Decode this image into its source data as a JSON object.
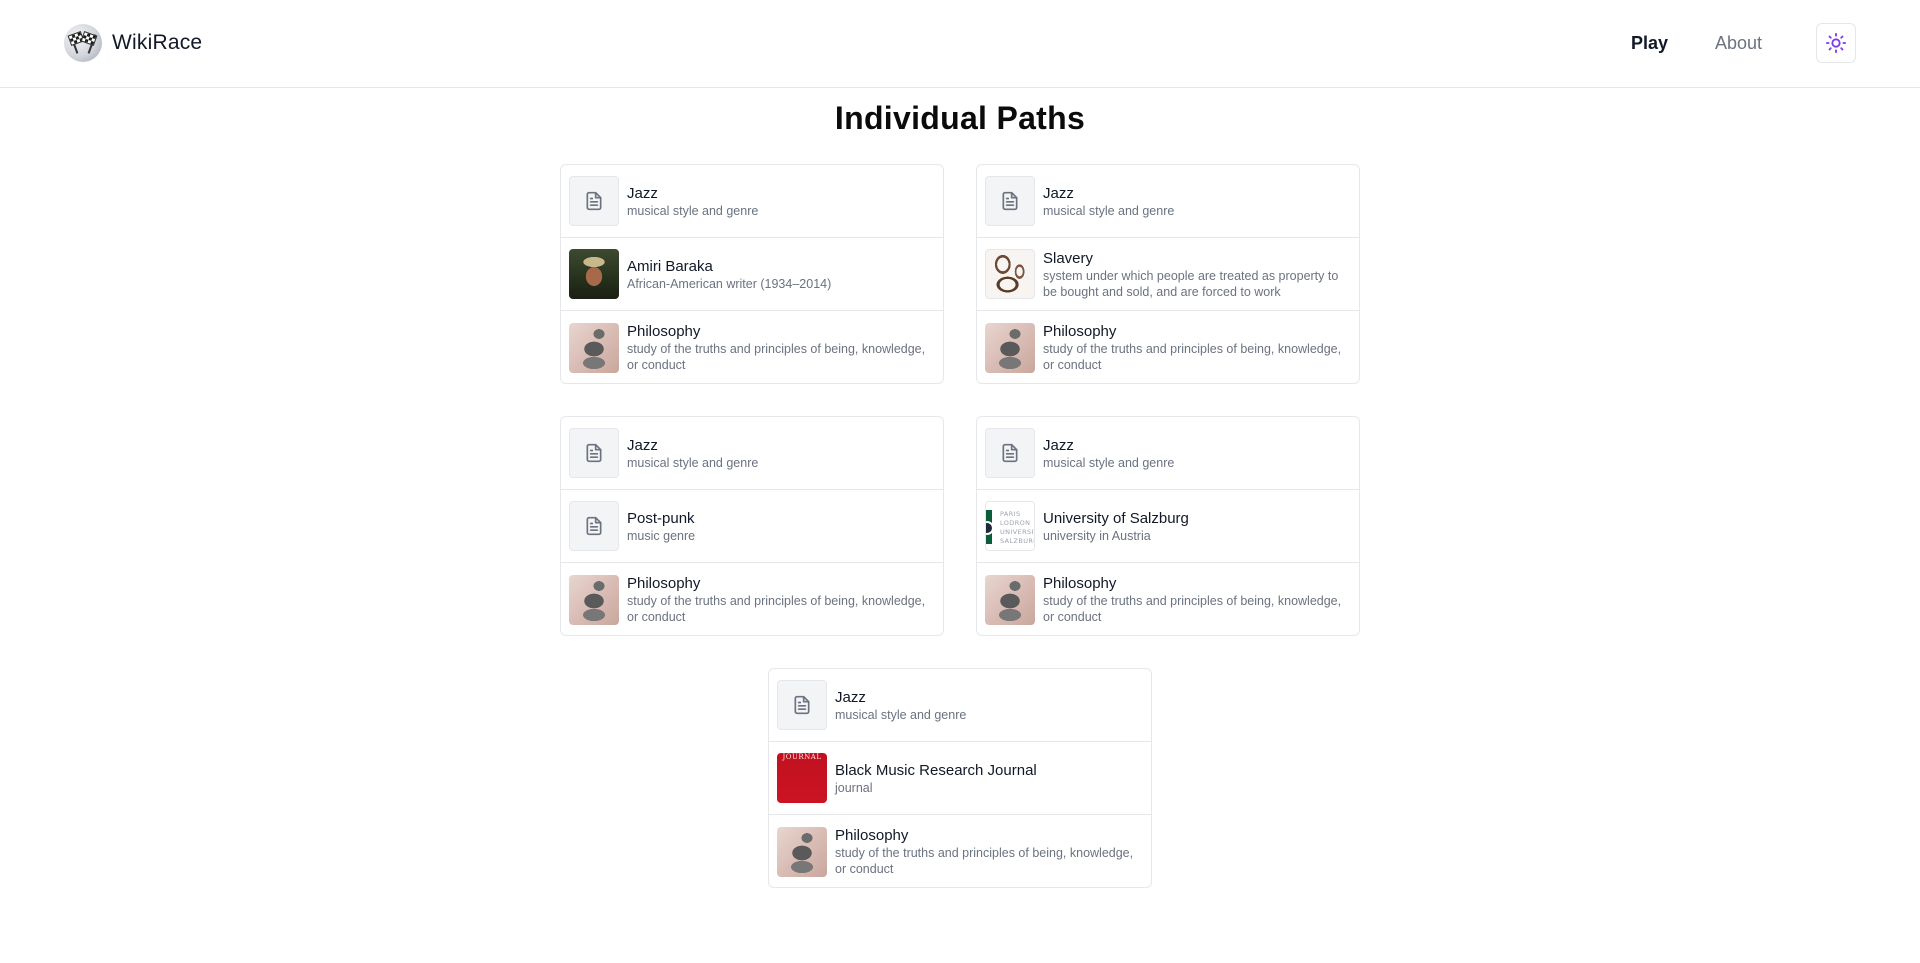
{
  "header": {
    "brand": "WikiRace",
    "nav": {
      "play": "Play",
      "about": "About"
    },
    "theme_icon": "sun-icon"
  },
  "page": {
    "title": "Individual Paths"
  },
  "paths": [
    [
      {
        "title": "Jazz",
        "desc": "musical style and genre",
        "thumb": "document-icon"
      },
      {
        "title": "Amiri Baraka",
        "desc": "African-American writer (1934–2014)",
        "thumb": "photo"
      },
      {
        "title": "Philosophy",
        "desc": "study of the truths and principles of being, knowledge, or conduct",
        "thumb": "photo"
      }
    ],
    [
      {
        "title": "Jazz",
        "desc": "musical style and genre",
        "thumb": "document-icon"
      },
      {
        "title": "Slavery",
        "desc": "system under which people are treated as property to be bought and sold, and are forced to work",
        "thumb": "photo"
      },
      {
        "title": "Philosophy",
        "desc": "study of the truths and principles of being, knowledge, or conduct",
        "thumb": "photo"
      }
    ],
    [
      {
        "title": "Jazz",
        "desc": "musical style and genre",
        "thumb": "document-icon"
      },
      {
        "title": "Post-punk",
        "desc": "music genre",
        "thumb": "document-icon"
      },
      {
        "title": "Philosophy",
        "desc": "study of the truths and principles of being, knowledge, or conduct",
        "thumb": "photo"
      }
    ],
    [
      {
        "title": "Jazz",
        "desc": "musical style and genre",
        "thumb": "document-icon"
      },
      {
        "title": "University of Salzburg",
        "desc": "university in Austria",
        "thumb": "logo",
        "logo_text": [
          "PARIS",
          "LODRON",
          "UNIVERSITÄT",
          "SALZBURG"
        ]
      },
      {
        "title": "Philosophy",
        "desc": "study of the truths and principles of being, knowledge, or conduct",
        "thumb": "photo"
      }
    ],
    [
      {
        "title": "Jazz",
        "desc": "musical style and genre",
        "thumb": "document-icon"
      },
      {
        "title": "Black Music Research Journal",
        "desc": "journal",
        "thumb": "cover",
        "cover_text": "JOURNAL"
      },
      {
        "title": "Philosophy",
        "desc": "study of the truths and principles of being, knowledge, or conduct",
        "thumb": "photo"
      }
    ]
  ],
  "colors": {
    "border": "#e5e7eb",
    "muted_text": "#6b7280",
    "accent_icon": "#7c3aed"
  }
}
